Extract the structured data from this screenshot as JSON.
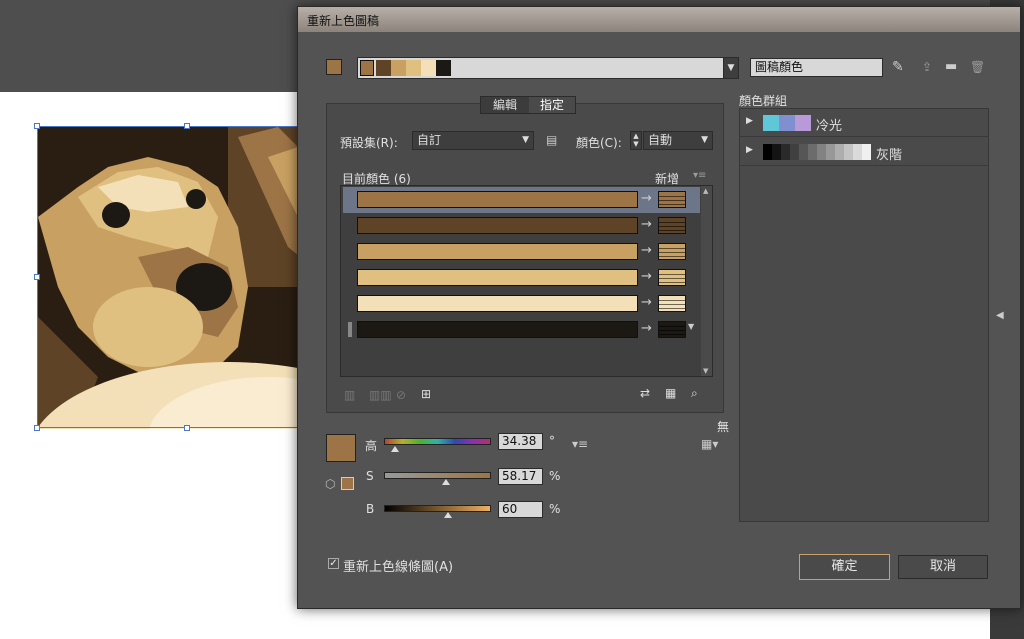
{
  "dialog": {
    "title": "重新上色圖稿",
    "colors_field_label": "圖稿顏色",
    "tabs": [
      "編輯",
      "指定"
    ],
    "preset_label": "預設集(R):",
    "preset_value": "自訂",
    "colors_label": "顏色(C):",
    "colors_value": "自動",
    "current_colors_label": "目前顏色 (6)",
    "new_label": "新增",
    "color_groups_label": "顏色群組",
    "groups": [
      {
        "name": "冷光",
        "swatches": [
          "#5ec8d8",
          "#7f8fd0",
          "#b89ad8"
        ]
      },
      {
        "name": "灰階",
        "swatches": [
          "#000000",
          "#141414",
          "#2a2a2a",
          "#404040",
          "#565656",
          "#6c6c6c",
          "#828282",
          "#989898",
          "#aeaeae",
          "#c4c4c4",
          "#dadada",
          "#f0f0f0"
        ]
      }
    ],
    "current_rows": [
      {
        "color": "#9c7446",
        "new_color": "#9c7446",
        "selected": true
      },
      {
        "color": "#5e4326",
        "new_color": "#5e4326",
        "selected": false
      },
      {
        "color": "#c8a062",
        "new_color": "#c8a062",
        "selected": false
      },
      {
        "color": "#e0c080",
        "new_color": "#e0c080",
        "selected": false
      },
      {
        "color": "#f4e0b8",
        "new_color": "#f4e0b8",
        "selected": false
      },
      {
        "color": "#1c1814",
        "new_color": "#1c1814",
        "selected": false
      }
    ],
    "fill_swatch": "#9c7446",
    "h_label": "高",
    "h_value": "34.38",
    "h_unit": "°",
    "s_label": "S",
    "s_value": "58.17",
    "s_unit": "%",
    "b_label": "B",
    "b_value": "60",
    "b_unit": "%",
    "none_label": "無",
    "recolor_checkbox_label": "重新上色線條圖(A)",
    "recolor_checked": true,
    "ok_label": "確定",
    "cancel_label": "取消",
    "strip_swatches": [
      "#9c7446",
      "#5e4326",
      "#c8a062",
      "#e0c080",
      "#f4e0b8",
      "#1c1814"
    ]
  }
}
